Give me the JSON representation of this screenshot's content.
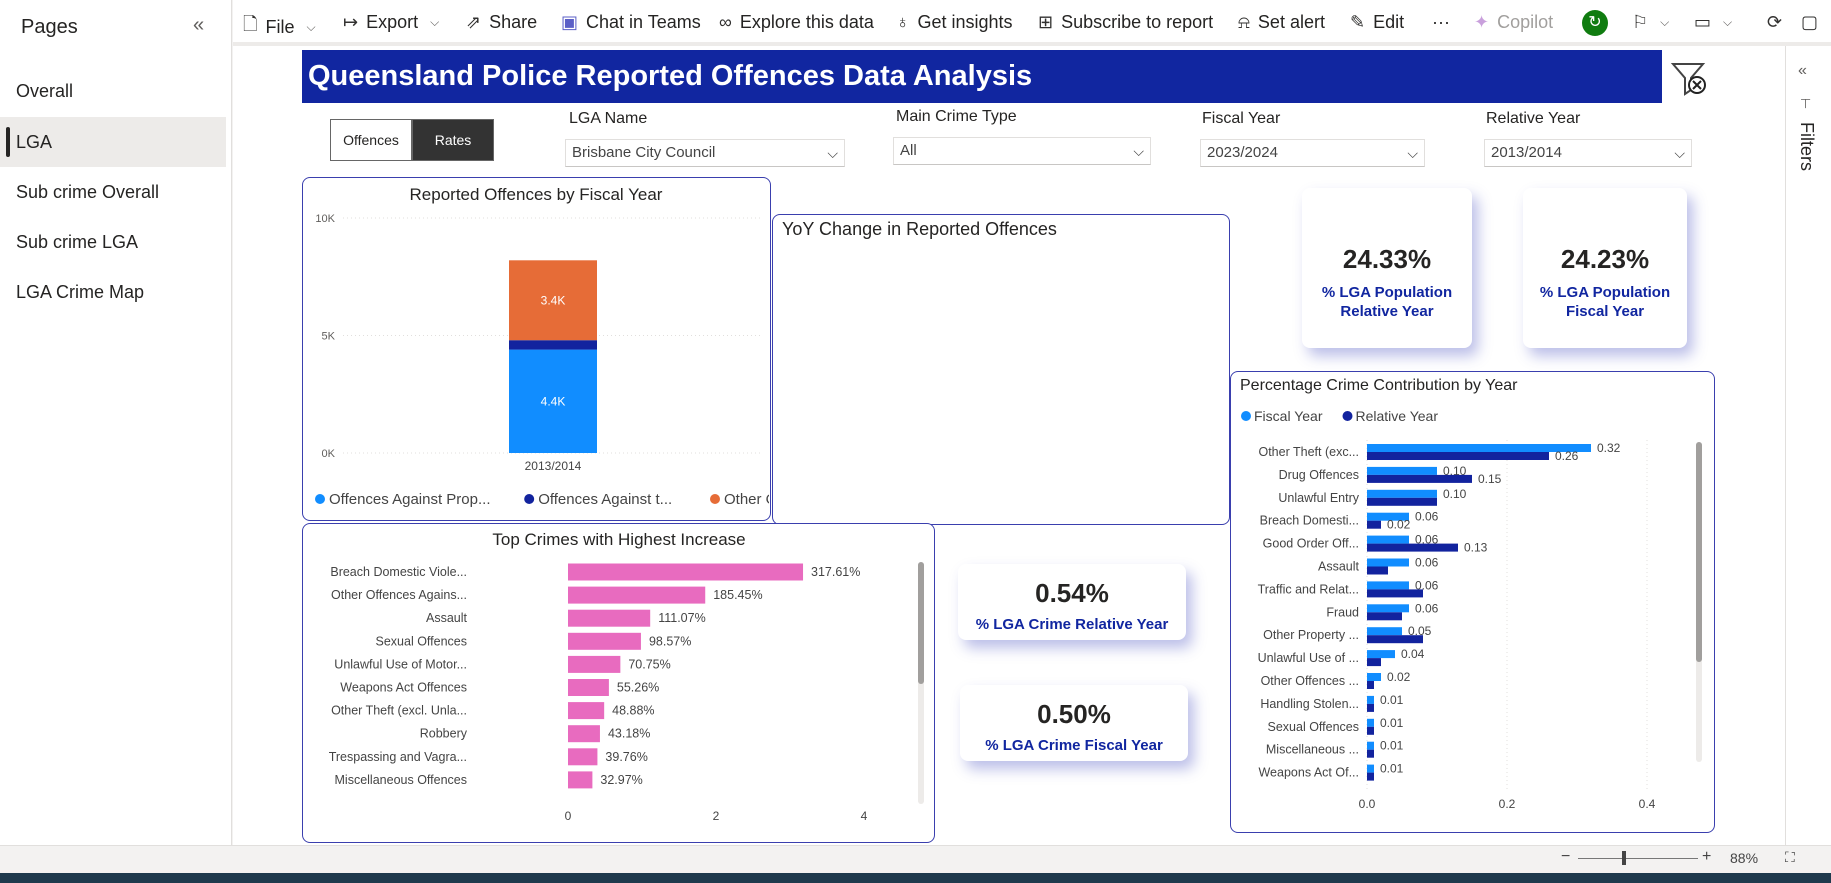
{
  "pages_pane": {
    "title": "Pages",
    "items": [
      {
        "label": "Overall"
      },
      {
        "label": "LGA"
      },
      {
        "label": "Sub crime Overall"
      },
      {
        "label": "Sub crime LGA"
      },
      {
        "label": "LGA Crime Map"
      }
    ],
    "active": "LGA"
  },
  "toolbar": {
    "file": "File",
    "export": "Export",
    "share": "Share",
    "chat_in_teams": "Chat in Teams",
    "explore": "Explore this data",
    "insights": "Get insights",
    "subscribe": "Subscribe to report",
    "alert": "Set alert",
    "edit": "Edit",
    "more": "···",
    "copilot": "Copilot"
  },
  "filters_pane": {
    "label": "Filters"
  },
  "status_bar": {
    "zoom": "88%"
  },
  "report": {
    "title": "Queensland Police Reported Offences Data Analysis",
    "toggle": {
      "offences": "Offences",
      "rates": "Rates",
      "selected": "Rates"
    },
    "slicers": [
      {
        "label": "LGA Name",
        "value": "Brisbane City Council"
      },
      {
        "label": "Main Crime Type",
        "value": "All"
      },
      {
        "label": "Fiscal Year",
        "value": "2023/2024"
      },
      {
        "label": "Relative Year",
        "value": "2013/2014"
      }
    ],
    "kpis": {
      "lga_pop_relative": {
        "value": "24.33%",
        "label": "% LGA Population Relative Year"
      },
      "lga_pop_fiscal": {
        "value": "24.23%",
        "label": "% LGA Population Fiscal Year"
      },
      "lga_crime_relative": {
        "value": "0.54%",
        "label": "% LGA  Crime Relative Year"
      },
      "lga_crime_fiscal": {
        "value": "0.50%",
        "label": "% LGA Crime Fiscal Year"
      }
    },
    "yoy_title": "YoY Change in Reported Offences"
  },
  "chart_data": [
    {
      "type": "bar",
      "stacked": true,
      "title": "Reported Offences by Fiscal Year",
      "categories": [
        "2013/2014"
      ],
      "y_ticks": [
        "0K",
        "5K",
        "10K"
      ],
      "ylim": [
        0,
        10000
      ],
      "series": [
        {
          "name": "Offences Against Prop...",
          "values": [
            4400
          ],
          "label": "4.4K",
          "color": "#118dff"
        },
        {
          "name": "Offences Against t...",
          "values": [
            400
          ],
          "label": "",
          "color": "#12239e"
        },
        {
          "name": "Other Offences",
          "values": [
            3400
          ],
          "label": "3.4K",
          "color": "#e66c37"
        }
      ],
      "legend": "bottom",
      "grid": true
    },
    {
      "type": "bar",
      "orientation": "horizontal",
      "title": "Top Crimes with Highest Increase",
      "categories": [
        "Breach Domestic Viole...",
        "Other Offences Agains...",
        "Assault",
        "Sexual Offences",
        "Unlawful Use of Motor...",
        "Weapons Act Offences",
        "Other Theft (excl. Unla...",
        "Robbery",
        "Trespassing and Vagra...",
        "Miscellaneous Offences"
      ],
      "values": [
        3.1761,
        1.8545,
        1.1107,
        0.9857,
        0.7075,
        0.5526,
        0.4888,
        0.4318,
        0.3976,
        0.3297
      ],
      "labels": [
        "317.61%",
        "185.45%",
        "111.07%",
        "98.57%",
        "70.75%",
        "55.26%",
        "48.88%",
        "43.18%",
        "39.76%",
        "32.97%"
      ],
      "x_ticks": [
        "0",
        "2",
        "4"
      ],
      "xlim": [
        0,
        4
      ],
      "color": "#e86bbf"
    },
    {
      "type": "bar",
      "orientation": "horizontal",
      "title": "Percentage Crime Contribution by Year",
      "categories": [
        "Other Theft (exc...",
        "Drug Offences",
        "Unlawful Entry",
        "Breach Domesti...",
        "Good Order Off...",
        "Assault",
        "Traffic and Relat...",
        "Fraud",
        "Other Property ...",
        "Unlawful Use of ...",
        "Other Offences ...",
        "Handling Stolen...",
        "Sexual Offences",
        "Miscellaneous ...",
        "Weapons Act Of..."
      ],
      "series": [
        {
          "name": "Fiscal Year",
          "color": "#118dff",
          "values": [
            0.32,
            0.1,
            0.1,
            0.06,
            0.06,
            0.06,
            0.06,
            0.06,
            0.05,
            0.04,
            0.02,
            0.01,
            0.01,
            0.01,
            0.01
          ],
          "labels": [
            "0.32",
            "0.10",
            "0.10",
            "0.06",
            "0.06",
            "0.06",
            "0.06",
            "0.06",
            "0.05",
            "0.04",
            "0.02",
            "0.01",
            "0.01",
            "0.01",
            "0.01"
          ]
        },
        {
          "name": "Relative Year",
          "color": "#12239e",
          "values": [
            0.26,
            0.15,
            0.1,
            0.02,
            0.13,
            0.03,
            0.08,
            0.05,
            0.08,
            0.02,
            0.01,
            0.01,
            0.01,
            0.01,
            0.01
          ],
          "labels": [
            "0.26",
            "0.15",
            "",
            "0.02",
            "0.13",
            "",
            "",
            "",
            "",
            "",
            "",
            "",
            "",
            "",
            ""
          ]
        }
      ],
      "x_ticks": [
        "0.0",
        "0.2",
        "0.4"
      ],
      "xlim": [
        0,
        0.4
      ],
      "legend": "top-left"
    }
  ]
}
